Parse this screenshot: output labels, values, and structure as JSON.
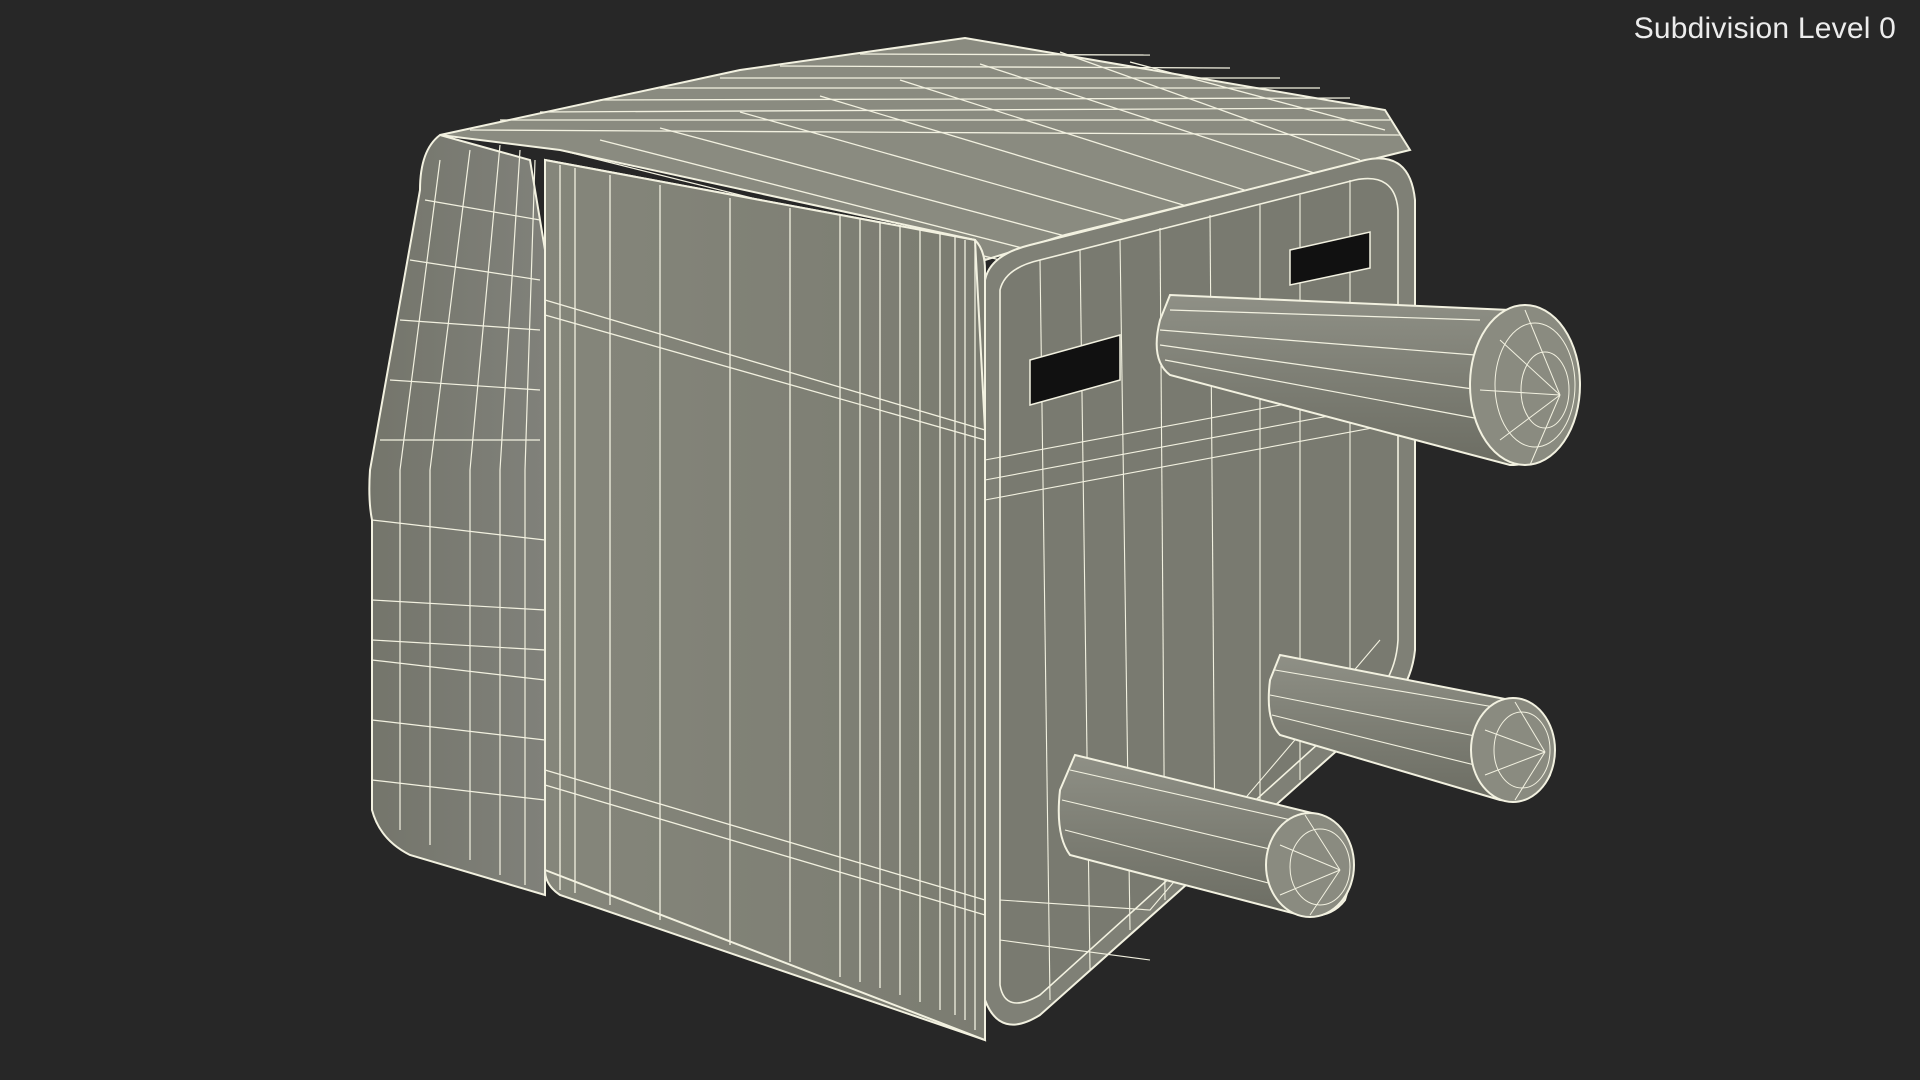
{
  "viewport": {
    "background_color": "#272727",
    "subdivision_label": "Subdivision Level 0"
  },
  "model": {
    "description_icon": "3d-mesh-wireframe",
    "surface_color": "#7e7f74",
    "wire_color": "#f2f1e0"
  }
}
